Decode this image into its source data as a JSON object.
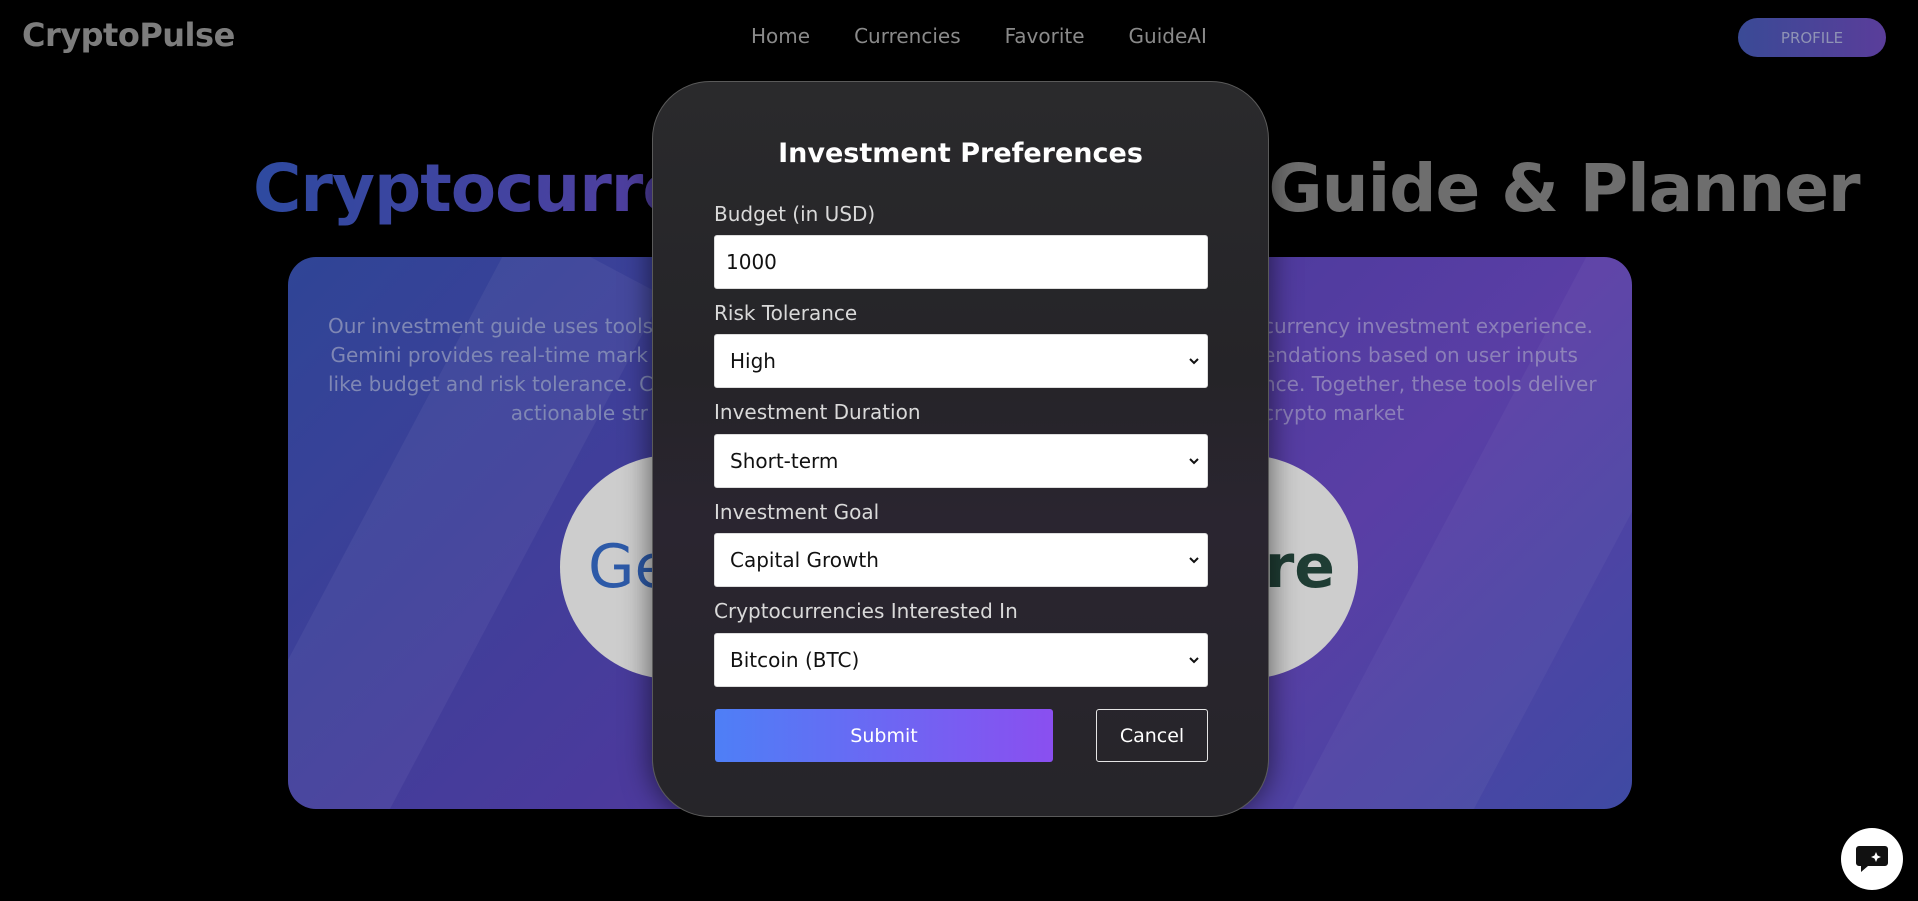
{
  "app": {
    "logo": "CryptoPulse"
  },
  "nav": {
    "items": [
      {
        "label": "Home"
      },
      {
        "label": "Currencies"
      },
      {
        "label": "Favorite"
      },
      {
        "label": "GuideAI"
      }
    ],
    "profile_label": "PROFILE"
  },
  "hero": {
    "title_highlight": "Cryptocurrency",
    "title_rest": " Investment Guide & Planner"
  },
  "card": {
    "left_text_lines": [
      "Our investment guide uses tools l",
      "Gemini provides real-time mark",
      "like budget and risk tolerance. Co",
      "actionable str"
    ],
    "right_text_lines": [
      "currency investment experience.",
      "endations based on user inputs",
      "nce. Together, these tools deliver",
      "crypto market"
    ],
    "left_logo_text": "Ge",
    "right_logo_text": "ere"
  },
  "modal": {
    "title": "Investment Preferences",
    "budget": {
      "label": "Budget (in USD)",
      "value": "1000"
    },
    "risk": {
      "label": "Risk Tolerance",
      "value": "High"
    },
    "duration": {
      "label": "Investment Duration",
      "value": "Short-term"
    },
    "goal": {
      "label": "Investment Goal",
      "value": "Capital Growth"
    },
    "crypto": {
      "label": "Cryptocurrencies Interested In",
      "value": "Bitcoin (BTC)"
    },
    "submit_label": "Submit",
    "cancel_label": "Cancel"
  },
  "icons": {
    "chat": "chat-bubble-sparkle-icon",
    "select": "chevron-down-icon"
  },
  "colors": {
    "accent_start": "#4e7ff6",
    "accent_end": "#8a4ff0",
    "background": "#000000"
  }
}
